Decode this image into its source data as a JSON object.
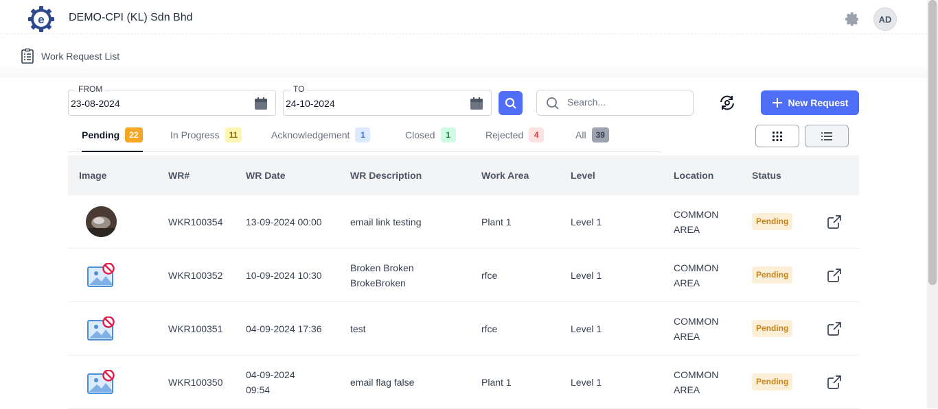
{
  "header": {
    "company": "DEMO-CPI (KL) Sdn Bhd",
    "avatar_initials": "AD",
    "breadcrumb": "Work Request List"
  },
  "filters": {
    "from_label": "FROM",
    "from_value": "23-08-2024",
    "to_label": "TO",
    "to_value": "24-10-2024",
    "search_placeholder": "Search...",
    "new_request_label": "New Request"
  },
  "tabs": [
    {
      "label": "Pending",
      "count": "22",
      "badge_bg": "#f5a623",
      "badge_fg": "#ffffff",
      "active": true
    },
    {
      "label": "In Progress",
      "count": "11",
      "badge_bg": "#fdf6b2",
      "badge_fg": "#8a6d00",
      "active": false
    },
    {
      "label": "Acknowledgement",
      "count": "1",
      "badge_bg": "#dbeafe",
      "badge_fg": "#3b6fd1",
      "active": false
    },
    {
      "label": "Closed",
      "count": "1",
      "badge_bg": "#d1fae5",
      "badge_fg": "#15803d",
      "active": false
    },
    {
      "label": "Rejected",
      "count": "4",
      "badge_bg": "#fde2e2",
      "badge_fg": "#d14343",
      "active": false
    },
    {
      "label": "All",
      "count": "39",
      "badge_bg": "#9ca3af",
      "badge_fg": "#374151",
      "active": false
    }
  ],
  "table": {
    "columns": [
      "Image",
      "WR#",
      "WR Date",
      "WR Description",
      "Work Area",
      "Level",
      "Location",
      "Status"
    ],
    "rows": [
      {
        "image": "photo",
        "wr": "WKR100354",
        "date": "13-09-2024 00:00",
        "desc": "email link testing",
        "area": "Plant 1",
        "level": "Level 1",
        "location": "COMMON AREA",
        "status": "Pending"
      },
      {
        "image": "no-image",
        "wr": "WKR100352",
        "date": "10-09-2024 10:30",
        "desc": "Broken Broken BrokeBroken",
        "area": "rfce",
        "level": "Level 1",
        "location": "COMMON AREA",
        "status": "Pending"
      },
      {
        "image": "no-image",
        "wr": "WKR100351",
        "date": "04-09-2024 17:36",
        "desc": "test",
        "area": "rfce",
        "level": "Level 1",
        "location": "COMMON AREA",
        "status": "Pending"
      },
      {
        "image": "no-image",
        "wr": "WKR100350",
        "date": "04-09-2024 09:54",
        "desc": "email flag false",
        "area": "Plant 1",
        "level": "Level 1",
        "location": "COMMON AREA",
        "status": "Pending"
      }
    ]
  },
  "colors": {
    "accent": "#4f6ef7",
    "pending_bg": "#fcefd7",
    "pending_fg": "#c7841a"
  }
}
